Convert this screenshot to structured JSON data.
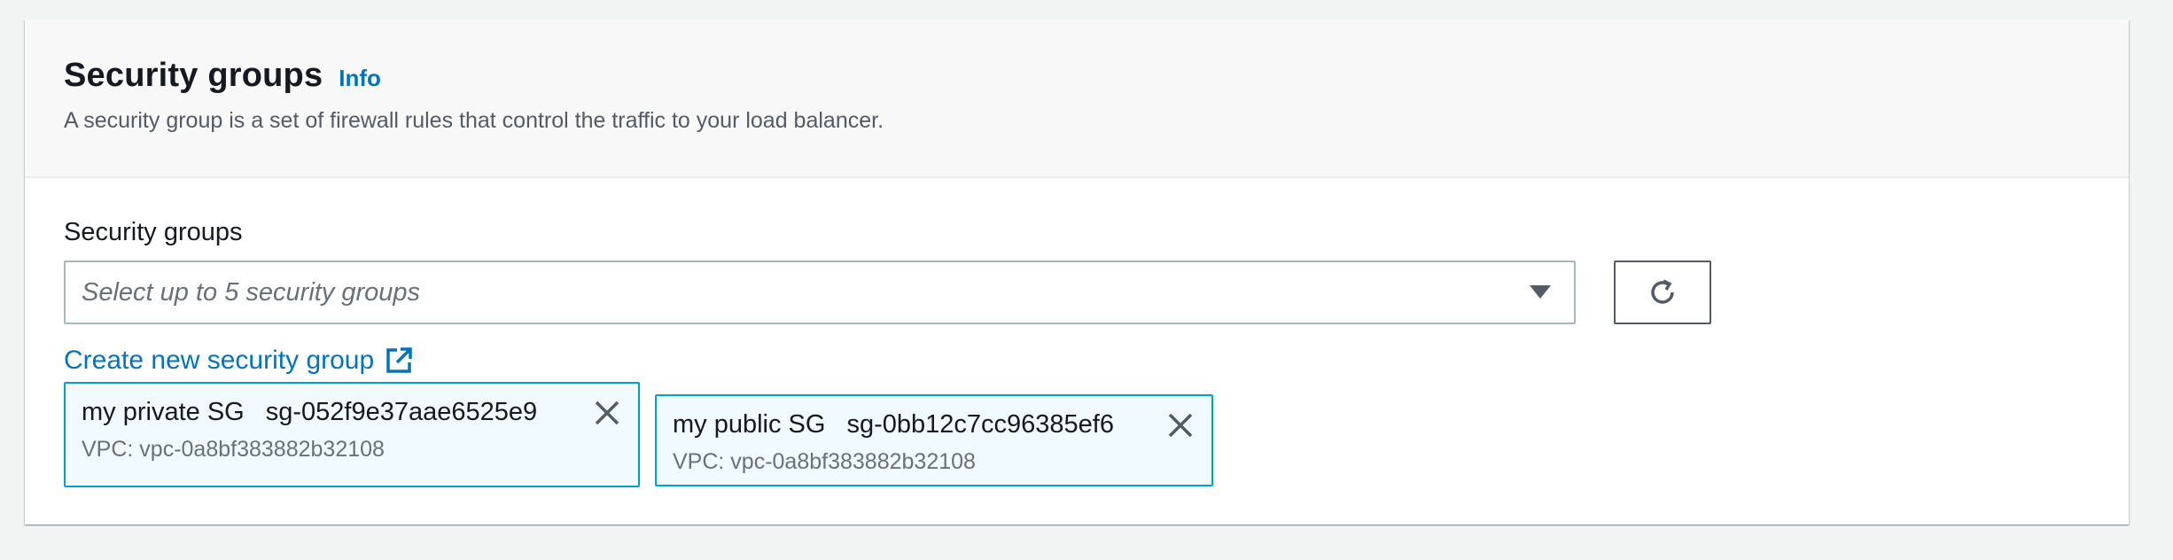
{
  "section": {
    "title": "Security groups",
    "info_label": "Info",
    "description": "A security group is a set of firewall rules that control the traffic to your load balancer."
  },
  "field": {
    "label": "Security groups",
    "placeholder": "Select up to 5 security groups",
    "create_link": "Create new security group"
  },
  "icons": {
    "dropdown": "caret-down-icon",
    "refresh": "refresh-icon",
    "external": "external-link-icon",
    "remove": "close-icon"
  },
  "selected_groups": [
    {
      "name": "my private SG",
      "id": "sg-052f9e37aae6525e9",
      "vpc": "VPC: vpc-0a8bf383882b32108"
    },
    {
      "name": "my public SG",
      "id": "sg-0bb12c7cc96385ef6",
      "vpc": "VPC: vpc-0a8bf383882b32108"
    }
  ],
  "colors": {
    "link": "#0073bb",
    "token_border": "#00a1c9",
    "token_background": "#f1faff",
    "header_background": "#f8f8f8",
    "page_background": "#f2f3f3"
  }
}
